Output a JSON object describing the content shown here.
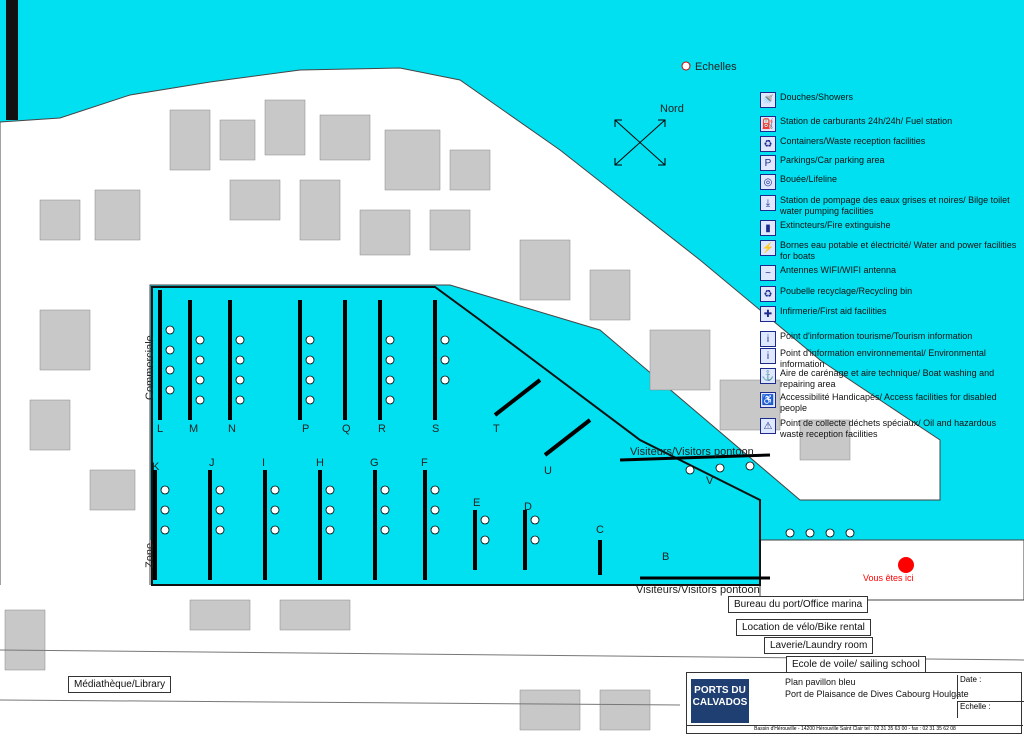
{
  "map": {
    "echelles": "Echelles",
    "nord": "Nord",
    "commerciale": "Commerciale",
    "zone": "Zone",
    "you_are_here": "Vous êtes ici",
    "visitors_top": "Visiteurs/Visitors pontoon",
    "visitors_bottom": "Visiteurs/Visitors pontoon",
    "piers": [
      "L",
      "M",
      "N",
      "P",
      "Q",
      "R",
      "S",
      "T",
      "U",
      "V",
      "K",
      "J",
      "I",
      "H",
      "G",
      "F",
      "E",
      "D",
      "C",
      "B"
    ],
    "water_color": "#00e0f0",
    "road_color": "#ffffff",
    "building_color": "#c8c8c8"
  },
  "legend": [
    {
      "icon": "shower-icon",
      "glyph": "🚿",
      "text": "Douches/Showers"
    },
    {
      "icon": "fuel-icon",
      "glyph": "⛽",
      "text": "Station de carburants 24h/24h/ Fuel station"
    },
    {
      "icon": "containers-icon",
      "glyph": "♻",
      "text": "Containers/Waste reception facilities"
    },
    {
      "icon": "parking-icon",
      "glyph": "P",
      "text": "Parkings/Car parking area"
    },
    {
      "icon": "lifebuoy-icon",
      "glyph": "◎",
      "text": "Bouée/Lifeline"
    },
    {
      "icon": "pump-icon",
      "glyph": "⤓",
      "text": "Station de pompage des eaux grises et noires/ Bilge toilet water pumping facilities"
    },
    {
      "icon": "extinguisher-icon",
      "glyph": "▮",
      "text": "Extincteurs/Fire extinguishe"
    },
    {
      "icon": "water-power-icon",
      "glyph": "⚡",
      "text": "Bornes eau potable et électricité/ Water and power facilities for boats"
    },
    {
      "icon": "wifi-icon",
      "glyph": "~",
      "text": "Antennes WIFI/WIFI antenna"
    },
    {
      "icon": "recycle-bin-icon",
      "glyph": "♻",
      "text": "Poubelle recyclage/Recycling bin"
    },
    {
      "icon": "first-aid-icon",
      "glyph": "✚",
      "text": "Infirmerie/First aid facilities"
    },
    {
      "icon": "tourism-info-icon",
      "glyph": "i",
      "text": "Point d'information tourisme/Tourism information"
    },
    {
      "icon": "environment-info-icon",
      "glyph": "i",
      "text": "Point d'information environnemental/ Environmental information"
    },
    {
      "icon": "careening-icon",
      "glyph": "⚓",
      "text": "Aire de carénage et aire technique/ Boat washing and repairing area"
    },
    {
      "icon": "accessibility-icon",
      "glyph": "♿",
      "text": "Accessibilité Handicapés/ Access facilities for disabled people"
    },
    {
      "icon": "hazardous-waste-icon",
      "glyph": "⚠",
      "text": "Point de collecte déchets spéciaux/ Oil and hazardous waste reception facilities"
    }
  ],
  "places": {
    "harbour_office": "Bureau du port/Office marina",
    "bike_rental": "Location de vélo/Bike rental",
    "laundry": "Laverie/Laundry room",
    "sailing_school": "Ecole de voile/ sailing school",
    "library": "Médiathèque/Library"
  },
  "footer": {
    "logo_line1": "PORTS DU",
    "logo_line2": "CALVADOS",
    "title": "Plan pavillon bleu",
    "subtitle": "Port de Plaisance de Dives Cabourg Houlgate",
    "date_label": "Date :",
    "scale_label": "Echelle :",
    "address": "Bassin d'Hérouville - 14200 Hérouville Saint Clair tel : 02 31 35 63 00 - fax : 02 31 35 62 08"
  }
}
